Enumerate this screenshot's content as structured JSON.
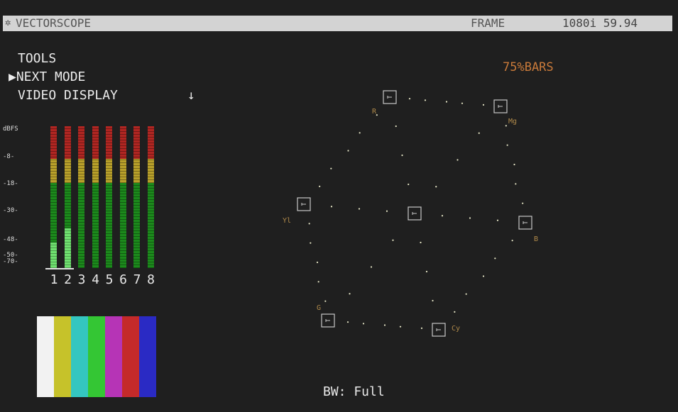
{
  "titlebar": {
    "icon": "gear-icon",
    "title": "VECTORSCOPE",
    "mode": "FRAME",
    "format": "1080i 59.94"
  },
  "menu": {
    "items": [
      {
        "label": "TOOLS"
      },
      {
        "label": "▶NEXT MODE"
      },
      {
        "label": "VIDEO DISPLAY"
      }
    ],
    "arrow": "↓"
  },
  "audio_meters": {
    "scale_labels": [
      "dBFS",
      "-8-",
      "-18-",
      "-30-",
      "-48-",
      "-50-",
      "-70-"
    ],
    "channel_labels": [
      "1",
      "2",
      "3",
      "4",
      "5",
      "6",
      "7",
      "8"
    ],
    "levels": [
      0.18,
      0.28,
      0,
      0,
      0,
      0,
      0,
      0
    ],
    "selected_channels": [
      "1",
      "2"
    ],
    "colors": {
      "red": "#b02622",
      "yellow": "#b8a02a",
      "green": "#1c8a1c",
      "lit": "#6fe06f"
    }
  },
  "color_bars": [
    "#f2f2f2",
    "#c6c22a",
    "#34c6c0",
    "#34c634",
    "#b634b6",
    "#c42a2a",
    "#2a2ac4"
  ],
  "vectorscope": {
    "standard": "75%BARS",
    "targets": [
      {
        "name": "R",
        "label": "R"
      },
      {
        "name": "Mg",
        "label": "Mg"
      },
      {
        "name": "B",
        "label": "B"
      },
      {
        "name": "Cy",
        "label": "Cy"
      },
      {
        "name": "G",
        "label": "G"
      },
      {
        "name": "Yl",
        "label": "Yl"
      }
    ],
    "trace_color": "#e8e8c8",
    "graticule_color": "#c8c8c8",
    "label_color": "#b08a4a"
  },
  "status": {
    "bandwidth": "BW: Full"
  }
}
